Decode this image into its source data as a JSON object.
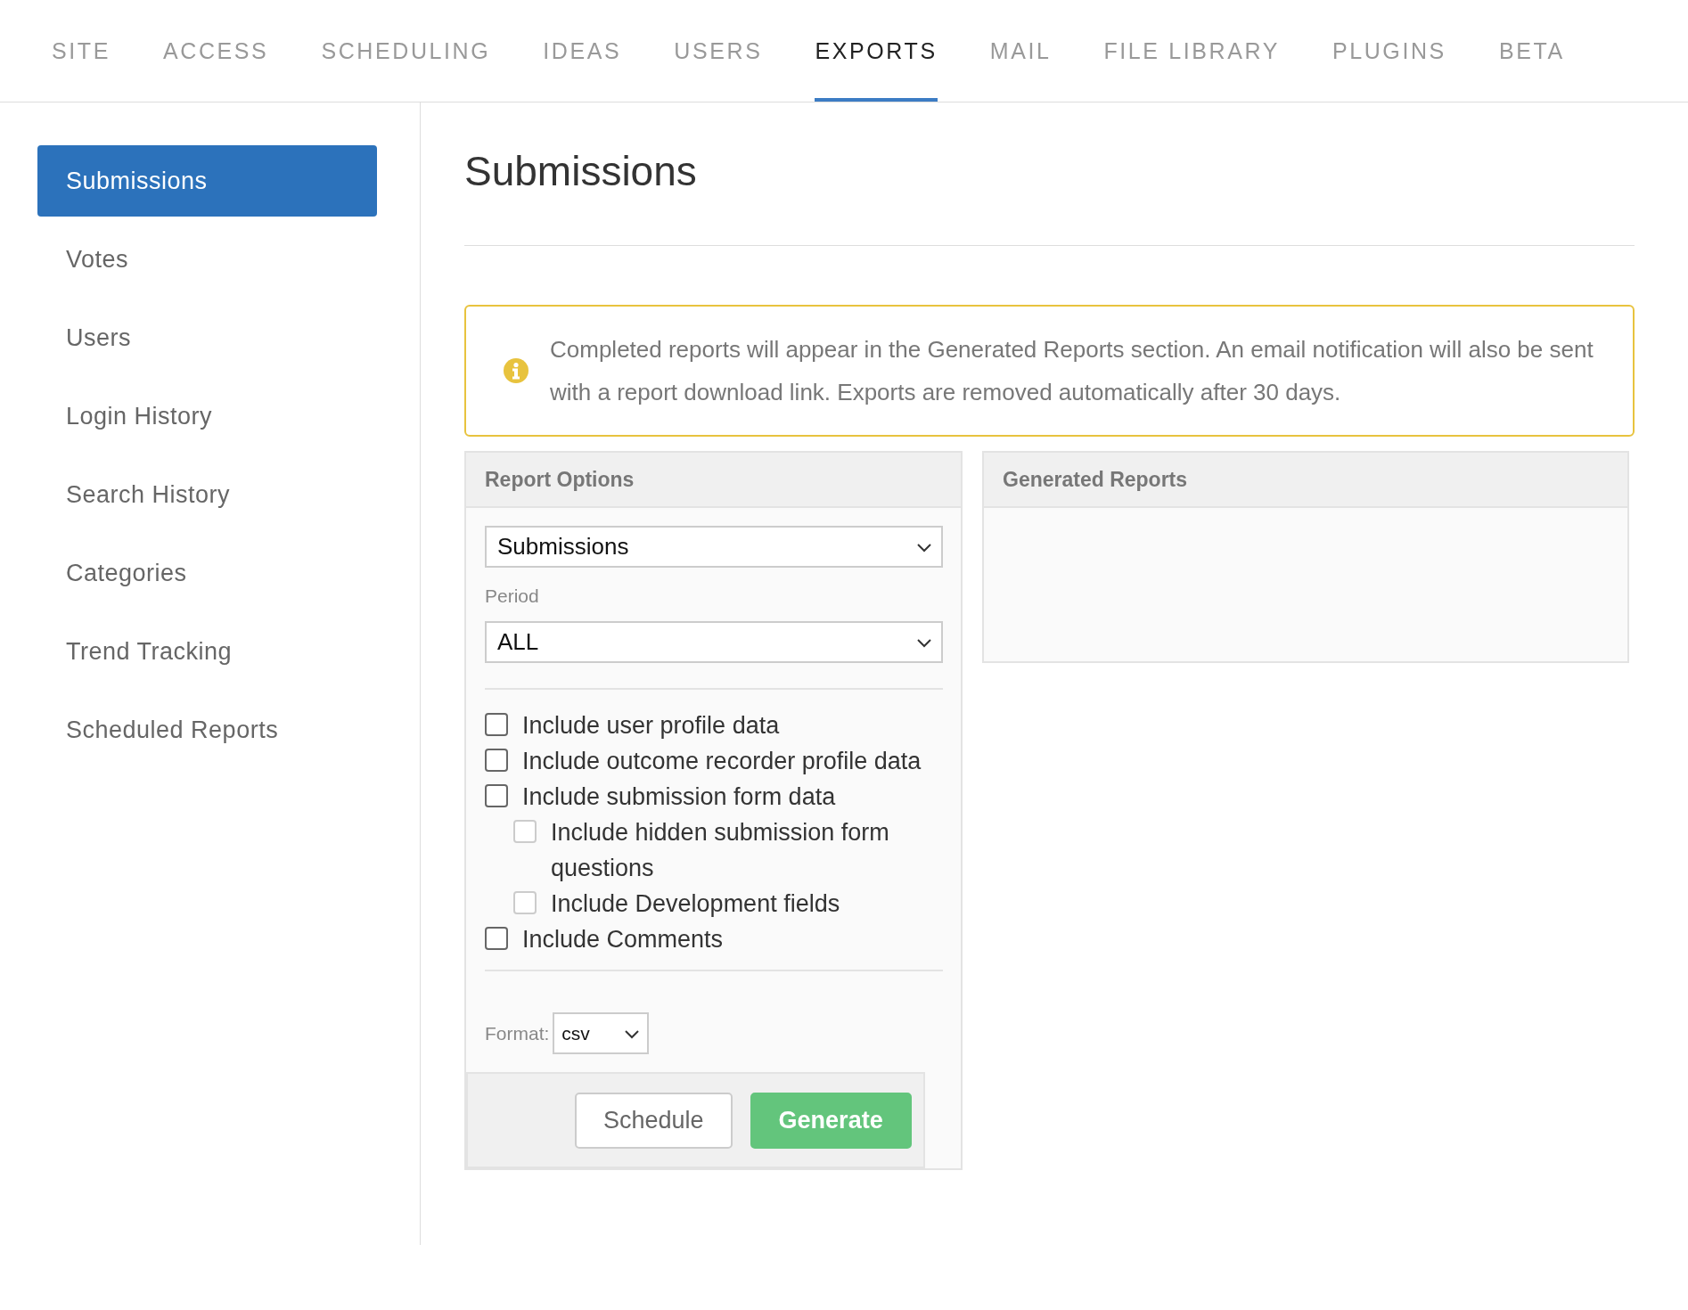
{
  "tabs": [
    {
      "label": "SITE",
      "selected": false
    },
    {
      "label": "ACCESS",
      "selected": false
    },
    {
      "label": "SCHEDULING",
      "selected": false
    },
    {
      "label": "IDEAS",
      "selected": false
    },
    {
      "label": "USERS",
      "selected": false
    },
    {
      "label": "EXPORTS",
      "selected": true
    },
    {
      "label": "MAIL",
      "selected": false
    },
    {
      "label": "FILE LIBRARY",
      "selected": false
    },
    {
      "label": "PLUGINS",
      "selected": false
    },
    {
      "label": "BETA",
      "selected": false
    }
  ],
  "sidebar": {
    "items": [
      {
        "label": "Submissions",
        "selected": true
      },
      {
        "label": "Votes",
        "selected": false
      },
      {
        "label": "Users",
        "selected": false
      },
      {
        "label": "Login History",
        "selected": false
      },
      {
        "label": "Search History",
        "selected": false
      },
      {
        "label": "Categories",
        "selected": false
      },
      {
        "label": "Trend Tracking",
        "selected": false
      },
      {
        "label": "Scheduled Reports",
        "selected": false
      }
    ]
  },
  "page_title": "Submissions",
  "notice": "Completed reports will appear in the Generated Reports section. An email notification will also be sent with a report download link. Exports are removed automatically after 30 days.",
  "report_options": {
    "title": "Report Options",
    "report_type": "Submissions",
    "period_label": "Period",
    "period": "ALL",
    "options": [
      {
        "label": "Include user profile data",
        "checked": false,
        "disabled": false
      },
      {
        "label": "Include outcome recorder profile data",
        "checked": false,
        "disabled": false
      },
      {
        "label": "Include submission form data",
        "checked": false,
        "disabled": false,
        "children": [
          {
            "label": "Include hidden submission form questions",
            "checked": false,
            "disabled": true
          },
          {
            "label": "Include Development fields",
            "checked": false,
            "disabled": true
          }
        ]
      },
      {
        "label": "Include Comments",
        "checked": false,
        "disabled": false
      }
    ],
    "format_label": "Format:",
    "format": "csv",
    "buttons": [
      {
        "label": "Schedule",
        "kind": "secondary"
      },
      {
        "label": "Generate",
        "kind": "primary"
      }
    ]
  },
  "generated_reports": {
    "title": "Generated Reports"
  }
}
